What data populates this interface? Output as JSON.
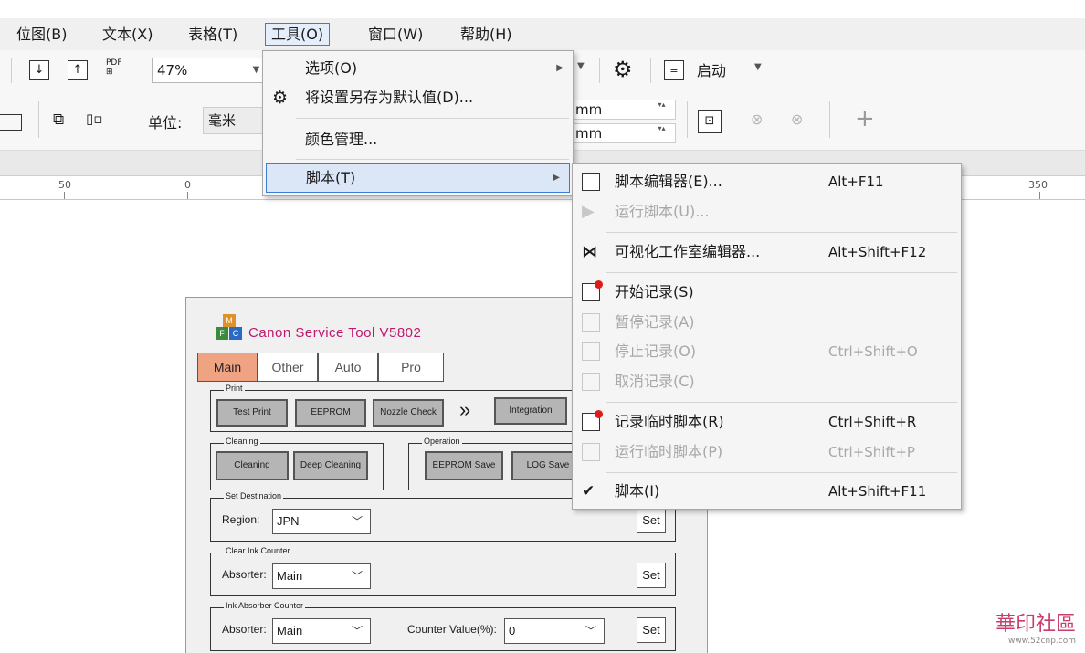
{
  "menubar": {
    "items": [
      {
        "label": "位图(B)"
      },
      {
        "label": "文本(X)"
      },
      {
        "label": "表格(T)"
      },
      {
        "label": "工具(O)"
      },
      {
        "label": "窗口(W)"
      },
      {
        "label": "帮助(H)"
      }
    ]
  },
  "toolbar": {
    "zoom": "47%",
    "pdf_label": "PDF",
    "launch_label": "启动",
    "unit_label": "单位:",
    "unit_value": "毫米",
    "nudge_unit_1": "mm",
    "nudge_unit_2": "mm",
    "plus_glyph": "+"
  },
  "ruler": {
    "labels": [
      "50",
      "0",
      "350"
    ]
  },
  "tools_menu": {
    "items": [
      {
        "label": "选项(O)"
      },
      {
        "label": "将设置另存为默认值(D)..."
      },
      {
        "label": "颜色管理..."
      },
      {
        "label": "脚本(T)"
      }
    ]
  },
  "script_menu": {
    "items": [
      {
        "label": "脚本编辑器(E)...",
        "shortcut": "Alt+F11",
        "enabled": true
      },
      {
        "label": "运行脚本(U)...",
        "shortcut": "",
        "enabled": false
      },
      {
        "label": "可视化工作室编辑器...",
        "shortcut": "Alt+Shift+F12",
        "enabled": true
      },
      {
        "label": "开始记录(S)",
        "shortcut": "",
        "enabled": true
      },
      {
        "label": "暂停记录(A)",
        "shortcut": "",
        "enabled": false
      },
      {
        "label": "停止记录(O)",
        "shortcut": "Ctrl+Shift+O",
        "enabled": false
      },
      {
        "label": "取消记录(C)",
        "shortcut": "",
        "enabled": false
      },
      {
        "label": "记录临时脚本(R)",
        "shortcut": "Ctrl+Shift+R",
        "enabled": true
      },
      {
        "label": "运行临时脚本(P)",
        "shortcut": "Ctrl+Shift+P",
        "enabled": false
      },
      {
        "label": "脚本(I)",
        "shortcut": "Alt+Shift+F11",
        "enabled": true,
        "checked": true
      }
    ]
  },
  "canon": {
    "title": "Canon Service Tool V5802",
    "logo_letters": [
      "M",
      "F",
      "C"
    ],
    "tabs": [
      {
        "label": "Main",
        "active": true
      },
      {
        "label": "Other"
      },
      {
        "label": "Auto"
      },
      {
        "label": "Pro"
      }
    ],
    "print_group": "Print",
    "print_buttons": [
      "Test Print",
      "EEPROM",
      "Nozzle Check"
    ],
    "more_glyph": "»",
    "integration": "Integration",
    "cleaning_group": "Cleaning",
    "cleaning_buttons": [
      "Cleaning",
      "Deep Cleaning"
    ],
    "operation_group": "Operation",
    "operation_buttons": [
      "EEPROM Save",
      "LOG Save"
    ],
    "set_dest_group": "Set Destination",
    "region_label": "Region:",
    "region_value": "JPN",
    "clear_ink_group": "Clear Ink Counter",
    "absorber_label": "Absorter:",
    "absorber_value": "Main",
    "ink_absorber_group": "Ink Absorber Counter",
    "counter_label": "Counter Value(%):",
    "counter_value": "0",
    "set_label": "Set"
  },
  "watermark": {
    "text": "華印社區",
    "url": "www.52cnp.com"
  }
}
